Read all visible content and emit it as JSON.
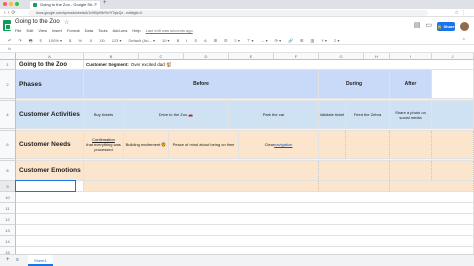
{
  "browser": {
    "tab_title": "Going to the Zoo - Google Sh...",
    "url": "docs.google.com/spreadsheets/d/1x9f0pH5rRxYfTqlzQx...edit#gid=0"
  },
  "app": {
    "doc_title": "Going to the Zoo",
    "menus": [
      "File",
      "Edit",
      "View",
      "Insert",
      "Format",
      "Data",
      "Tools",
      "Add-ons",
      "Help"
    ],
    "last_edit": "Last edit was seconds ago",
    "share_label": "Share",
    "icons": [
      "comment-icon",
      "present-icon",
      "lock-icon"
    ],
    "accent_color": "#1a73e8"
  },
  "toolbar": {
    "items": [
      "↶",
      "↷",
      "🖶",
      "¶",
      "100% ▾",
      "$",
      "%",
      ".0",
      ".00",
      "123 ▾",
      "Default (Ari... ▾",
      "10 ▾",
      "B",
      "I",
      "S",
      "A",
      "⊞",
      "⊟",
      "≡ ▾",
      "⊤ ▾",
      "↔ ▾",
      "⟳ ▾",
      "🔗",
      "⊞",
      "▥",
      "Y ▾",
      "Σ ▾"
    ],
    "collapse": "⌃"
  },
  "formula": {
    "fx": "fx"
  },
  "grid": {
    "columns": [
      "A",
      "B",
      "C",
      "D",
      "E",
      "F",
      "G",
      "H",
      "I",
      "J"
    ],
    "rows": [
      "1",
      "2",
      "3",
      "4",
      "5",
      "6",
      "7",
      "8",
      "9",
      "10",
      "11",
      "12",
      "13",
      "14",
      "15",
      "16"
    ],
    "title": "Going to the Zoo",
    "segment_label": "Customer Segment:",
    "segment_value": "Over excited dad 🐒",
    "phases_label": "Phases",
    "phases": [
      "Before",
      "During",
      "After"
    ],
    "activities_label": "Customer Activities",
    "activities": [
      "Buy tickets",
      "Drive to the Zoo 🚗",
      "Park the car",
      "Validate ticket",
      "Feed the Zebra",
      "Share a photo on social media"
    ],
    "needs_label": "Customer Needs",
    "needs": {
      "confirmation_title": "Confirmation",
      "confirmation_text": "that everything was processed",
      "excitement": "Building excitement 🦁",
      "peace": "Peace of mind about being on time",
      "clear_prefix": "Clear ",
      "clear_link": "navigation"
    },
    "emotions_label": "Customer Emotions",
    "colors": {
      "phases": "#c9daf8",
      "activities": "#cfe2f3",
      "needs": "#fce5cd"
    }
  },
  "sheet_tabs": [
    "Sheet1"
  ]
}
